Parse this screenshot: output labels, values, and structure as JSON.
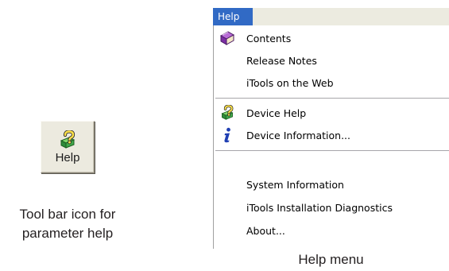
{
  "toolbar_button": {
    "label": "Help",
    "icon": "question-help-icon"
  },
  "left_caption": {
    "line1": "Tool bar icon for",
    "line2": "parameter help"
  },
  "menu": {
    "title": "Help",
    "items": [
      {
        "label": "Contents",
        "icon": "book-icon"
      },
      {
        "label": "Release Notes",
        "icon": ""
      },
      {
        "label": "iTools on the Web",
        "icon": ""
      },
      {
        "label": "Device Help",
        "icon": "question-help-icon"
      },
      {
        "label": "Device Information...",
        "icon": "info-icon"
      },
      {
        "label": "System Information",
        "icon": ""
      },
      {
        "label": "iTools Installation Diagnostics",
        "icon": ""
      },
      {
        "label": "About...",
        "icon": ""
      }
    ]
  },
  "right_caption": "Help menu",
  "colors": {
    "menu_highlight": "#316ac5",
    "menubar_bg": "#ecebe0",
    "button_face": "#eceadf"
  }
}
